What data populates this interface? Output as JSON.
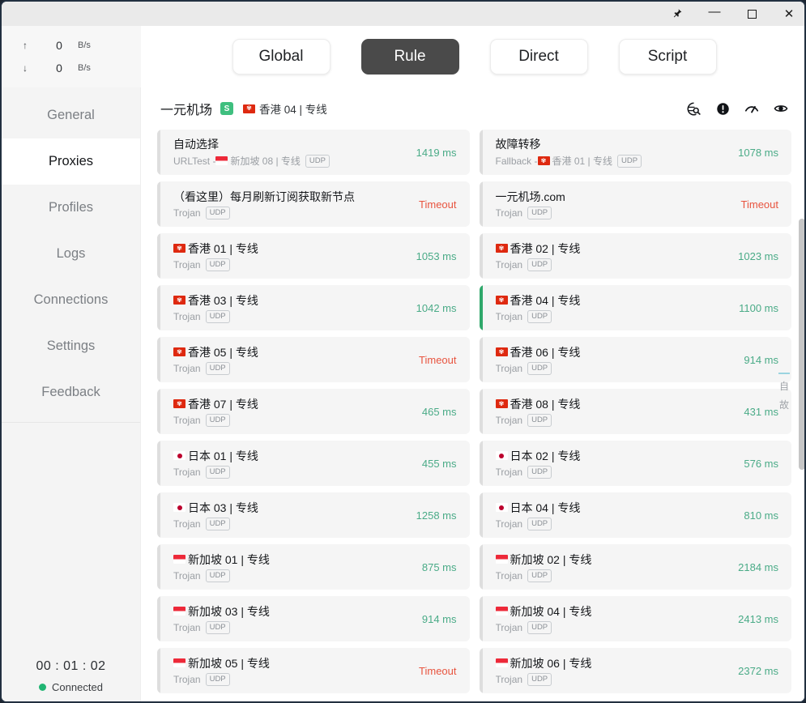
{
  "titlebar": {
    "pin_label": "📌",
    "minimize_label": "—",
    "maximize_label": "",
    "close_label": "✕"
  },
  "speed": {
    "up_arrow": "↑",
    "up_value": "0",
    "up_unit": "B/s",
    "down_arrow": "↓",
    "down_value": "0",
    "down_unit": "B/s"
  },
  "modes": [
    {
      "label": "Global",
      "active": false
    },
    {
      "label": "Rule",
      "active": true
    },
    {
      "label": "Direct",
      "active": false
    },
    {
      "label": "Script",
      "active": false
    }
  ],
  "sidebar": {
    "items": [
      {
        "label": "General",
        "active": false
      },
      {
        "label": "Proxies",
        "active": true
      },
      {
        "label": "Profiles",
        "active": false
      },
      {
        "label": "Logs",
        "active": false
      },
      {
        "label": "Connections",
        "active": false
      },
      {
        "label": "Settings",
        "active": false
      },
      {
        "label": "Feedback",
        "active": false
      }
    ],
    "uptime": "00 : 01 : 02",
    "connection_status": "Connected",
    "connection_color": "#21b573"
  },
  "group": {
    "title": "一元机场",
    "badge": "S",
    "badge_color": "#3fbf7f",
    "current_flag": "hk",
    "current_name": "香港 04 | 专线",
    "icons": [
      {
        "name": "globe-search-icon",
        "glyph": "🌐"
      },
      {
        "name": "alert-circle-icon",
        "glyph": "❗"
      },
      {
        "name": "speedtest-icon",
        "glyph": "⚡"
      },
      {
        "name": "eye-icon",
        "glyph": "👁"
      }
    ]
  },
  "colors": {
    "latency_ok": "#4aab87",
    "latency_bad": "#e8543f",
    "selected_stripe": "#2fa86b",
    "mode_active_bg": "#4a4a4a"
  },
  "index_rail": {
    "dash": "—",
    "chars": [
      "自",
      "故"
    ]
  },
  "proxies": [
    {
      "flag": "",
      "name": "自动选择",
      "sub": "URLTest - ",
      "sub_flag": "sg",
      "sub_tail": "新加坡 08 | 专线",
      "udp": "UDP",
      "latency": "1419 ms",
      "status": "ok",
      "selected": false
    },
    {
      "flag": "",
      "name": "故障转移",
      "sub": "Fallback - ",
      "sub_flag": "hk",
      "sub_tail": "香港 01 | 专线",
      "udp": "UDP",
      "latency": "1078 ms",
      "status": "ok",
      "selected": false
    },
    {
      "flag": "",
      "name": "（看这里）每月刷新订阅获取新节点",
      "sub": "Trojan",
      "sub_flag": "",
      "sub_tail": "",
      "udp": "UDP",
      "latency": "Timeout",
      "status": "bad",
      "selected": false
    },
    {
      "flag": "",
      "name": "一元机场.com",
      "sub": "Trojan",
      "sub_flag": "",
      "sub_tail": "",
      "udp": "UDP",
      "latency": "Timeout",
      "status": "bad",
      "selected": false
    },
    {
      "flag": "hk",
      "name": "香港 01 | 专线",
      "sub": "Trojan",
      "sub_flag": "",
      "sub_tail": "",
      "udp": "UDP",
      "latency": "1053 ms",
      "status": "ok",
      "selected": false
    },
    {
      "flag": "hk",
      "name": "香港 02 | 专线",
      "sub": "Trojan",
      "sub_flag": "",
      "sub_tail": "",
      "udp": "UDP",
      "latency": "1023 ms",
      "status": "ok",
      "selected": false
    },
    {
      "flag": "hk",
      "name": "香港 03 | 专线",
      "sub": "Trojan",
      "sub_flag": "",
      "sub_tail": "",
      "udp": "UDP",
      "latency": "1042 ms",
      "status": "ok",
      "selected": false
    },
    {
      "flag": "hk",
      "name": "香港 04 | 专线",
      "sub": "Trojan",
      "sub_flag": "",
      "sub_tail": "",
      "udp": "UDP",
      "latency": "1100 ms",
      "status": "ok",
      "selected": true
    },
    {
      "flag": "hk",
      "name": "香港 05 | 专线",
      "sub": "Trojan",
      "sub_flag": "",
      "sub_tail": "",
      "udp": "UDP",
      "latency": "Timeout",
      "status": "bad",
      "selected": false
    },
    {
      "flag": "hk",
      "name": "香港 06 | 专线",
      "sub": "Trojan",
      "sub_flag": "",
      "sub_tail": "",
      "udp": "UDP",
      "latency": "914 ms",
      "status": "ok",
      "selected": false
    },
    {
      "flag": "hk",
      "name": "香港 07 | 专线",
      "sub": "Trojan",
      "sub_flag": "",
      "sub_tail": "",
      "udp": "UDP",
      "latency": "465 ms",
      "status": "ok",
      "selected": false
    },
    {
      "flag": "hk",
      "name": "香港 08 | 专线",
      "sub": "Trojan",
      "sub_flag": "",
      "sub_tail": "",
      "udp": "UDP",
      "latency": "431 ms",
      "status": "ok",
      "selected": false
    },
    {
      "flag": "jp",
      "name": "日本 01 | 专线",
      "sub": "Trojan",
      "sub_flag": "",
      "sub_tail": "",
      "udp": "UDP",
      "latency": "455 ms",
      "status": "ok",
      "selected": false
    },
    {
      "flag": "jp",
      "name": "日本 02 | 专线",
      "sub": "Trojan",
      "sub_flag": "",
      "sub_tail": "",
      "udp": "UDP",
      "latency": "576 ms",
      "status": "ok",
      "selected": false
    },
    {
      "flag": "jp",
      "name": "日本 03 | 专线",
      "sub": "Trojan",
      "sub_flag": "",
      "sub_tail": "",
      "udp": "UDP",
      "latency": "1258 ms",
      "status": "ok",
      "selected": false
    },
    {
      "flag": "jp",
      "name": "日本 04 | 专线",
      "sub": "Trojan",
      "sub_flag": "",
      "sub_tail": "",
      "udp": "UDP",
      "latency": "810 ms",
      "status": "ok",
      "selected": false
    },
    {
      "flag": "sg",
      "name": "新加坡 01 | 专线",
      "sub": "Trojan",
      "sub_flag": "",
      "sub_tail": "",
      "udp": "UDP",
      "latency": "875 ms",
      "status": "ok",
      "selected": false
    },
    {
      "flag": "sg",
      "name": "新加坡 02 | 专线",
      "sub": "Trojan",
      "sub_flag": "",
      "sub_tail": "",
      "udp": "UDP",
      "latency": "2184 ms",
      "status": "ok",
      "selected": false
    },
    {
      "flag": "sg",
      "name": "新加坡 03 | 专线",
      "sub": "Trojan",
      "sub_flag": "",
      "sub_tail": "",
      "udp": "UDP",
      "latency": "914 ms",
      "status": "ok",
      "selected": false
    },
    {
      "flag": "sg",
      "name": "新加坡 04 | 专线",
      "sub": "Trojan",
      "sub_flag": "",
      "sub_tail": "",
      "udp": "UDP",
      "latency": "2413 ms",
      "status": "ok",
      "selected": false
    },
    {
      "flag": "sg",
      "name": "新加坡 05 | 专线",
      "sub": "Trojan",
      "sub_flag": "",
      "sub_tail": "",
      "udp": "UDP",
      "latency": "Timeout",
      "status": "bad",
      "selected": false
    },
    {
      "flag": "sg",
      "name": "新加坡 06 | 专线",
      "sub": "Trojan",
      "sub_flag": "",
      "sub_tail": "",
      "udp": "UDP",
      "latency": "2372 ms",
      "status": "ok",
      "selected": false
    }
  ]
}
